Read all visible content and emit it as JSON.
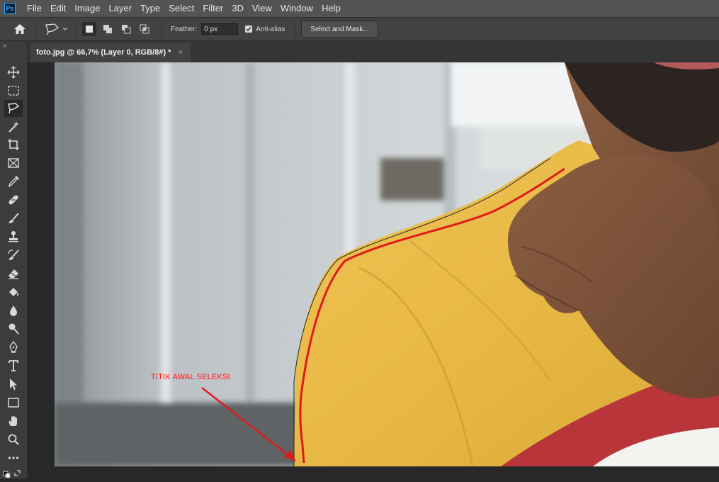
{
  "app": {
    "logo_text": "Ps"
  },
  "menu": [
    "File",
    "Edit",
    "Image",
    "Layer",
    "Type",
    "Select",
    "Filter",
    "3D",
    "View",
    "Window",
    "Help"
  ],
  "options": {
    "feather_label": "Feather:",
    "feather_value": "0 px",
    "anti_alias_label": "Anti-alias",
    "anti_alias_checked": true,
    "select_mask_label": "Select and Mask..."
  },
  "toolbar": {
    "collapse": "»",
    "tools": [
      "move-tool",
      "rectangular-marquee-tool",
      "polygonal-lasso-tool",
      "magic-wand-tool",
      "crop-tool",
      "frame-tool",
      "eyedropper-tool",
      "healing-brush-tool",
      "brush-tool",
      "clone-stamp-tool",
      "history-brush-tool",
      "eraser-tool",
      "paint-bucket-tool",
      "blur-tool",
      "dodge-tool",
      "pen-tool",
      "type-tool",
      "path-selection-tool",
      "rectangle-tool",
      "hand-tool",
      "zoom-tool",
      "more-tools"
    ],
    "active_tool": "polygonal-lasso-tool"
  },
  "document": {
    "tab_title": "foto.jpg @ 66,7% (Layer 0, RGB/8#) *",
    "tab_close": "×"
  },
  "annotation": {
    "text": "TITIK AWAL SELEKSI",
    "color": "#ff1a1a"
  }
}
